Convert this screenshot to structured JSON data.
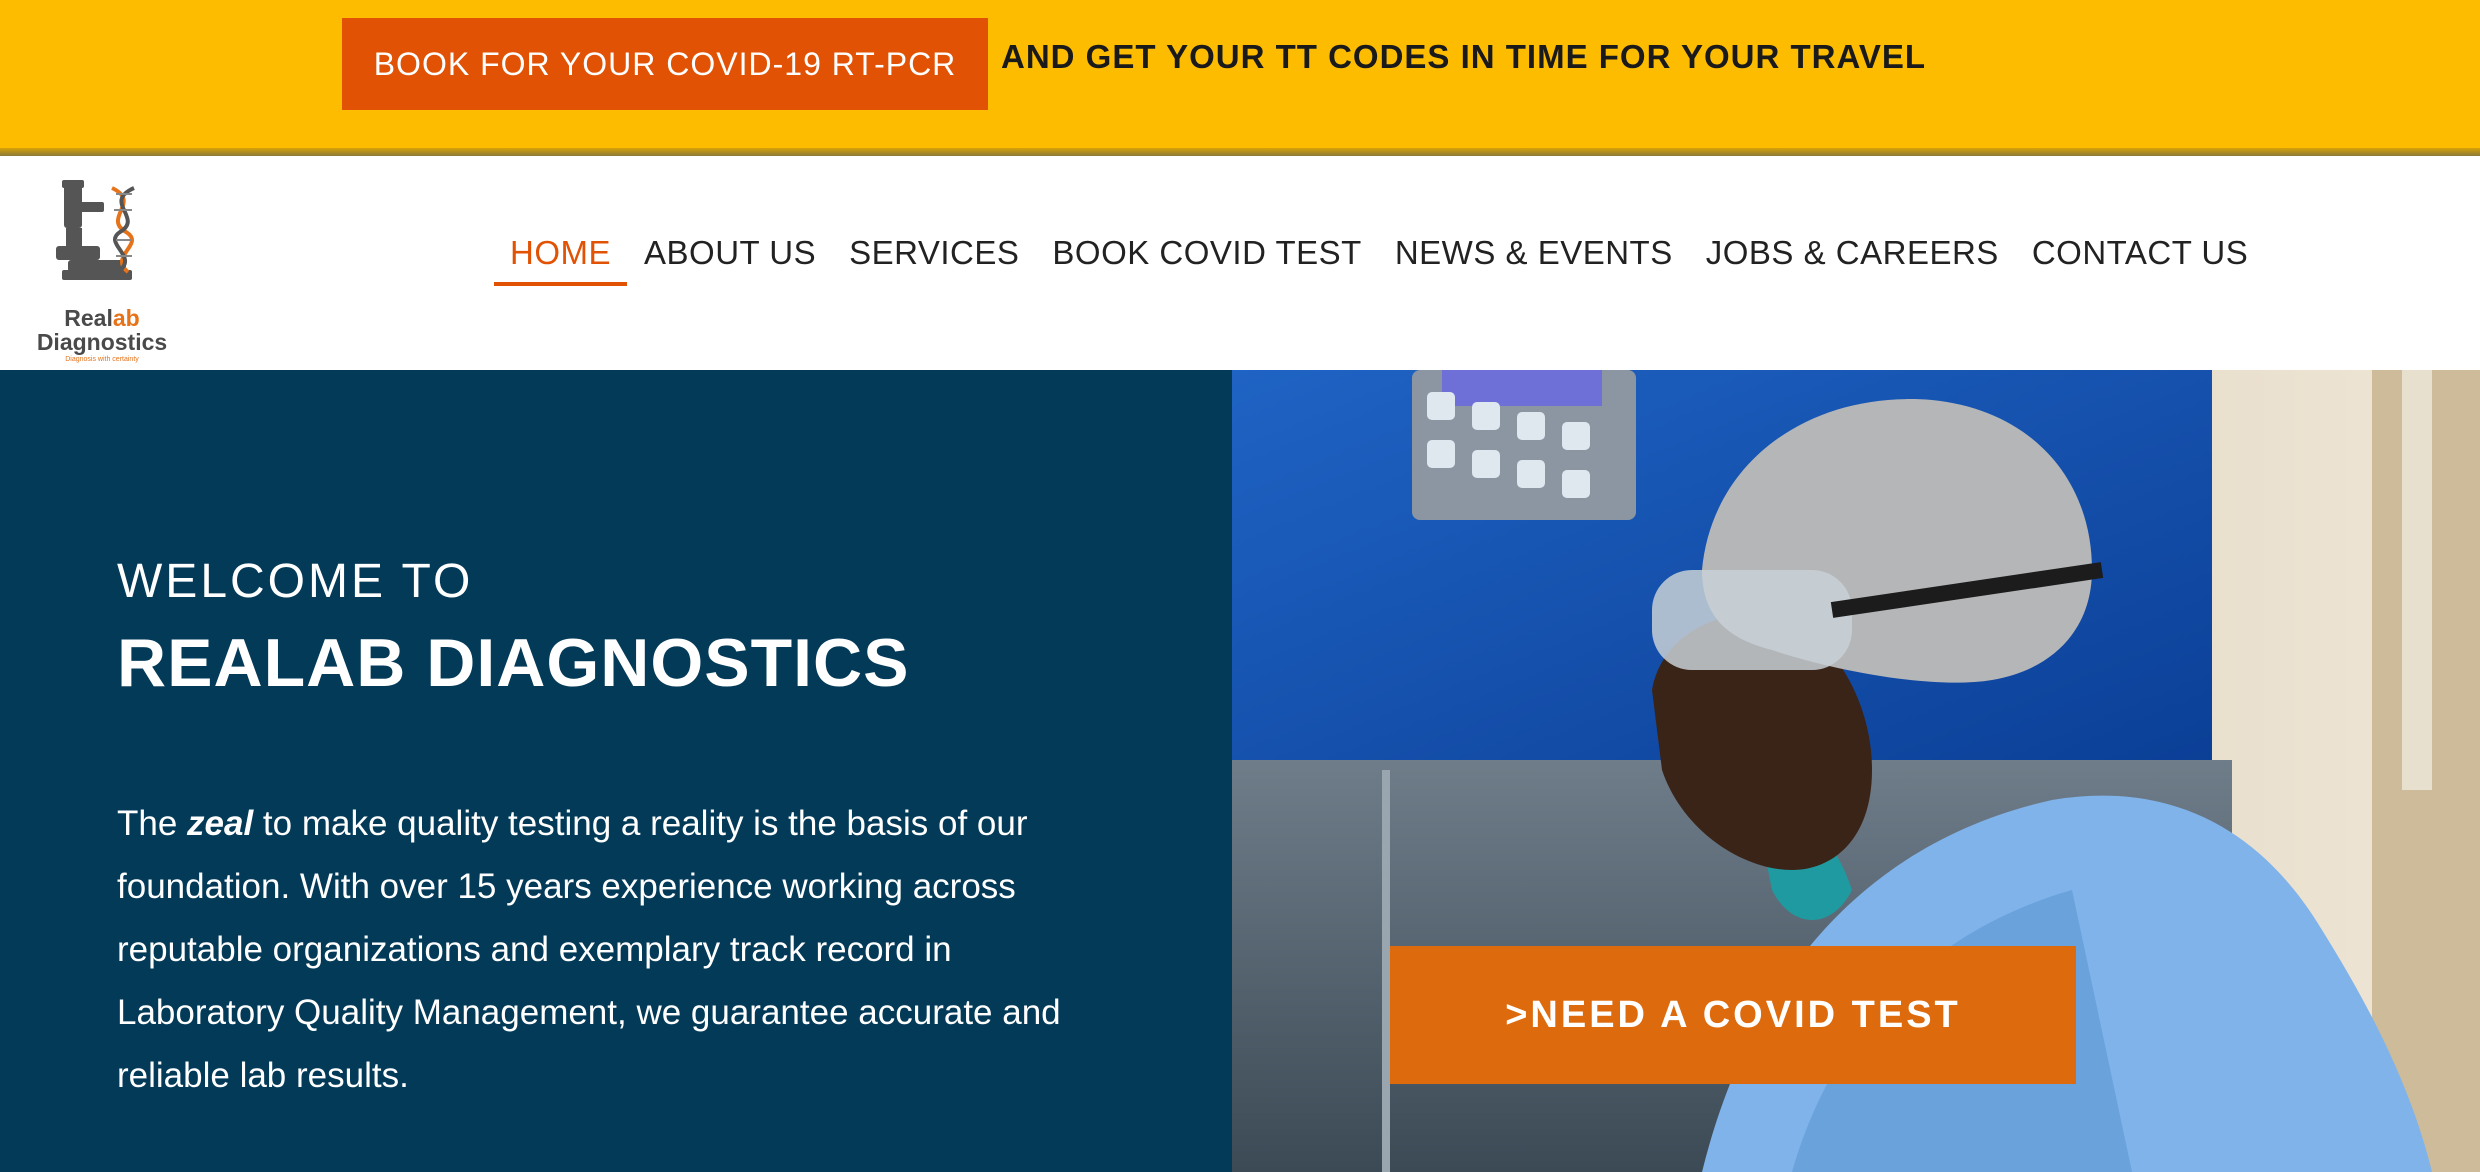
{
  "promo": {
    "button_label": "BOOK FOR YOUR COVID-19 RT-PCR",
    "text": "AND GET YOUR TT CODES IN TIME FOR YOUR TRAVEL"
  },
  "logo": {
    "name_part1": "Real",
    "name_part2": "ab",
    "name_line2": "Diagnostics",
    "tagline": "Diagnosis with certainty",
    "icon": "microscope-dna-icon"
  },
  "nav": {
    "items": [
      {
        "label": "HOME",
        "active": true
      },
      {
        "label": "ABOUT US"
      },
      {
        "label": "SERVICES"
      },
      {
        "label": "BOOK COVID TEST"
      },
      {
        "label": "NEWS & EVENTS"
      },
      {
        "label": "JOBS & CAREERS"
      },
      {
        "label": "CONTACT US"
      }
    ]
  },
  "hero": {
    "welcome": "WELCOME TO",
    "title": "REALAB DIAGNOSTICS",
    "body_before": "The ",
    "body_emphasis": "zeal",
    "body_after": " to make quality testing a reality is the basis of our foundation. With over 15 years experience working across reputable organizations and exemplary track record in Laboratory Quality Management, we guarantee accurate and reliable lab results.",
    "cta_label": ">NEED A COVID TEST"
  },
  "colors": {
    "promo_bar": "#fdbc00",
    "promo_button": "#e15205",
    "hero_background": "#033a58",
    "cta": "#dd6a0c",
    "nav_active": "#e15205"
  }
}
